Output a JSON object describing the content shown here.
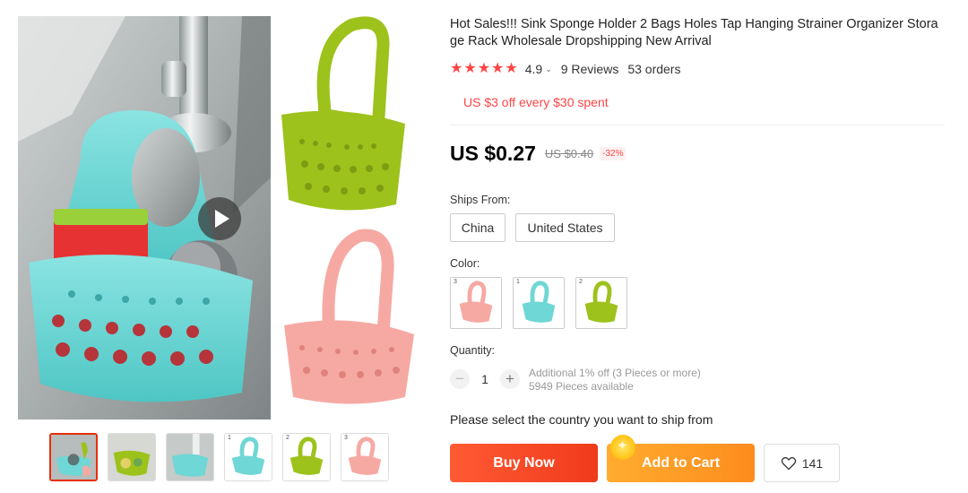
{
  "product": {
    "title": "Hot Sales!!! Sink Sponge Holder 2 Bags Holes Tap Hanging Strainer Organizer Storage Rack Wholesale Dropshipping New Arrival",
    "rating": "4.9",
    "rating_stars": 5,
    "reviews": "9 Reviews",
    "orders": "53 orders",
    "coupon": "US $3 off every $30 spent",
    "price": "US $0.27",
    "old_price": "US $0.40",
    "discount": "-32%"
  },
  "shipping": {
    "label": "Ships From:",
    "options": [
      "China",
      "United States"
    ]
  },
  "color": {
    "label": "Color:",
    "options": [
      {
        "num": "3",
        "color": "#f6a9a3"
      },
      {
        "num": "1",
        "color": "#6fd7d5"
      },
      {
        "num": "2",
        "color": "#9dc21c"
      }
    ]
  },
  "quantity": {
    "label": "Quantity:",
    "value": "1",
    "minus": "−",
    "plus": "+",
    "note_discount": "Additional 1% off (3 Pieces or more)",
    "note_available": "5949 Pieces available"
  },
  "ship_message": "Please select the country you want to ship from",
  "actions": {
    "buy_now": "Buy Now",
    "add_to_cart": "Add to Cart",
    "wishlist_count": "141"
  },
  "thumbnails": [
    {
      "num": "",
      "color": "#6fd7d5"
    },
    {
      "num": "",
      "color": "#9dc21c"
    },
    {
      "num": "",
      "color": "#6fd7d5"
    },
    {
      "num": "1",
      "color": "#6fd7d5"
    },
    {
      "num": "2",
      "color": "#9dc21c"
    },
    {
      "num": "3",
      "color": "#f6a9a3"
    }
  ],
  "theme": {
    "accent": "#f44444",
    "buy_now": "#f03b1c",
    "add_to_cart": "#fe8c1d"
  }
}
